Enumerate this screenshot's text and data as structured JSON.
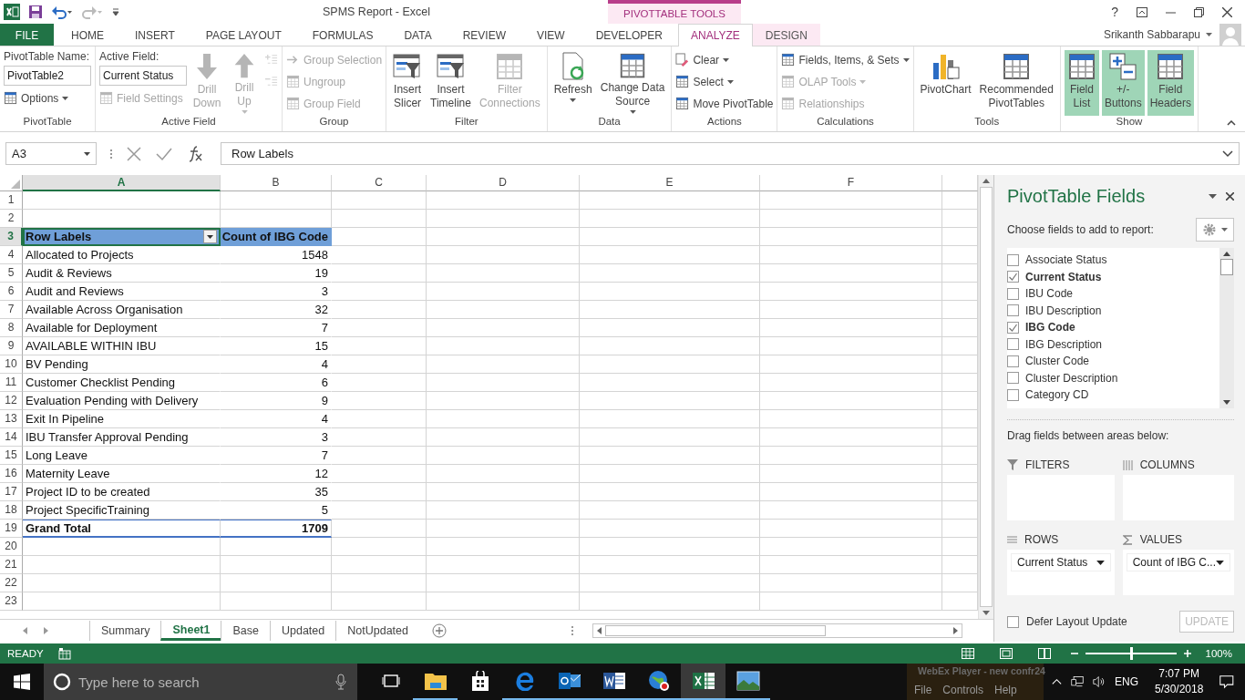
{
  "window": {
    "title": "SPMS Report - Excel",
    "help": "?",
    "context_group": "PIVOTTABLE TOOLS",
    "user": "Srikanth Sabbarapu"
  },
  "tabs": [
    {
      "label": "FILE",
      "kind": "file",
      "selected": false
    },
    {
      "label": "HOME",
      "kind": "normal",
      "selected": false
    },
    {
      "label": "INSERT",
      "kind": "normal",
      "selected": false
    },
    {
      "label": "PAGE LAYOUT",
      "kind": "normal",
      "selected": false
    },
    {
      "label": "FORMULAS",
      "kind": "normal",
      "selected": false
    },
    {
      "label": "DATA",
      "kind": "normal",
      "selected": false
    },
    {
      "label": "REVIEW",
      "kind": "normal",
      "selected": false
    },
    {
      "label": "VIEW",
      "kind": "normal",
      "selected": false
    },
    {
      "label": "DEVELOPER",
      "kind": "normal",
      "selected": false
    },
    {
      "label": "ANALYZE",
      "kind": "context",
      "selected": true
    },
    {
      "label": "DESIGN",
      "kind": "context",
      "selected": false
    }
  ],
  "ribbon": {
    "groups": [
      {
        "title": "PivotTable",
        "columns": [
          [
            {
              "kind": "field",
              "label": "PivotTable Name:",
              "value": "PivotTable2"
            },
            {
              "kind": "small",
              "label": "Options",
              "dropdown": true,
              "disabled": false
            }
          ]
        ]
      },
      {
        "title": "Active Field",
        "columns": [
          [
            {
              "kind": "field",
              "label": "Active Field:",
              "value": "Current Status"
            },
            {
              "kind": "small",
              "label": "Field Settings",
              "dropdown": false,
              "disabled": true
            }
          ],
          [
            {
              "kind": "large",
              "lines": [
                "Drill",
                "Down"
              ],
              "dropdown": false,
              "disabled": true
            }
          ],
          [
            {
              "kind": "large",
              "lines": [
                "Drill",
                "Up"
              ],
              "dropdown": true,
              "disabled": true
            }
          ],
          [
            {
              "kind": "icon",
              "disabled": true
            },
            {
              "kind": "icon",
              "disabled": true
            }
          ]
        ]
      },
      {
        "title": "Group",
        "columns": [
          [
            {
              "kind": "small",
              "label": "Group Selection",
              "dropdown": false,
              "disabled": true
            },
            {
              "kind": "small",
              "label": "Ungroup",
              "dropdown": false,
              "disabled": true
            },
            {
              "kind": "small",
              "label": "Group Field",
              "dropdown": false,
              "disabled": true
            }
          ]
        ]
      },
      {
        "title": "Filter",
        "columns": [
          [
            {
              "kind": "large",
              "lines": [
                "Insert",
                "Slicer"
              ],
              "dropdown": false,
              "disabled": false
            }
          ],
          [
            {
              "kind": "large",
              "lines": [
                "Insert",
                "Timeline"
              ],
              "dropdown": false,
              "disabled": false
            }
          ],
          [
            {
              "kind": "large",
              "lines": [
                "Filter",
                "Connections"
              ],
              "dropdown": false,
              "disabled": true
            }
          ]
        ]
      },
      {
        "title": "Data",
        "columns": [
          [
            {
              "kind": "large",
              "lines": [
                "Refresh"
              ],
              "dropdown": true,
              "disabled": false
            }
          ],
          [
            {
              "kind": "large",
              "lines": [
                "Change Data",
                "Source"
              ],
              "dropdown": true,
              "disabled": false
            }
          ]
        ]
      },
      {
        "title": "Actions",
        "columns": [
          [
            {
              "kind": "small",
              "label": "Clear",
              "dropdown": true,
              "disabled": false
            },
            {
              "kind": "small",
              "label": "Select",
              "dropdown": true,
              "disabled": false
            },
            {
              "kind": "small",
              "label": "Move PivotTable",
              "dropdown": false,
              "disabled": false
            }
          ]
        ]
      },
      {
        "title": "Calculations",
        "columns": [
          [
            {
              "kind": "small",
              "label": "Fields, Items, & Sets",
              "dropdown": true,
              "disabled": false
            },
            {
              "kind": "small",
              "label": "OLAP Tools",
              "dropdown": true,
              "disabled": true
            },
            {
              "kind": "small",
              "label": "Relationships",
              "dropdown": false,
              "disabled": true
            }
          ]
        ]
      },
      {
        "title": "Tools",
        "columns": [
          [
            {
              "kind": "large",
              "lines": [
                "PivotChart"
              ],
              "dropdown": false,
              "disabled": false
            }
          ],
          [
            {
              "kind": "large",
              "lines": [
                "Recommended",
                "PivotTables"
              ],
              "dropdown": false,
              "disabled": false
            }
          ]
        ]
      },
      {
        "title": "Show",
        "columns": [
          [
            {
              "kind": "large",
              "lines": [
                "Field",
                "List"
              ],
              "dropdown": false,
              "disabled": false,
              "on": true
            }
          ],
          [
            {
              "kind": "large",
              "lines": [
                "+/-",
                "Buttons"
              ],
              "dropdown": false,
              "disabled": false,
              "on": true
            }
          ],
          [
            {
              "kind": "large",
              "lines": [
                "Field",
                "Headers"
              ],
              "dropdown": false,
              "disabled": false,
              "on": true
            }
          ]
        ]
      }
    ]
  },
  "formula_bar": {
    "name_box": "A3",
    "formula": "Row Labels"
  },
  "sheet": {
    "columns": [
      "A",
      "B",
      "C",
      "D",
      "E",
      "F"
    ],
    "rows": [
      {
        "num": "1",
        "kind": "blank",
        "selected": false
      },
      {
        "num": "2",
        "kind": "blank",
        "selected": false
      },
      {
        "num": "3",
        "kind": "header",
        "label": "Row Labels",
        "value": "Count of IBG Code",
        "selected": true
      },
      {
        "num": "4",
        "kind": "item",
        "label": "Allocated to Projects",
        "value": "1548",
        "selected": false
      },
      {
        "num": "5",
        "kind": "item",
        "label": "Audit & Reviews",
        "value": "19",
        "selected": false
      },
      {
        "num": "6",
        "kind": "item",
        "label": "Audit and Reviews",
        "value": "3",
        "selected": false
      },
      {
        "num": "7",
        "kind": "item",
        "label": "Available Across Organisation",
        "value": "32",
        "selected": false
      },
      {
        "num": "8",
        "kind": "item",
        "label": "Available for Deployment",
        "value": "7",
        "selected": false
      },
      {
        "num": "9",
        "kind": "item",
        "label": "AVAILABLE WITHIN IBU",
        "value": "15",
        "selected": false
      },
      {
        "num": "10",
        "kind": "item",
        "label": "BV Pending",
        "value": "4",
        "selected": false
      },
      {
        "num": "11",
        "kind": "item",
        "label": "Customer Checklist Pending",
        "value": "6",
        "selected": false
      },
      {
        "num": "12",
        "kind": "item",
        "label": "Evaluation Pending with Delivery",
        "value": "9",
        "selected": false
      },
      {
        "num": "13",
        "kind": "item",
        "label": "Exit In Pipeline",
        "value": "4",
        "selected": false
      },
      {
        "num": "14",
        "kind": "item",
        "label": "IBU Transfer Approval Pending",
        "value": "3",
        "selected": false
      },
      {
        "num": "15",
        "kind": "item",
        "label": "Long Leave",
        "value": "7",
        "selected": false
      },
      {
        "num": "16",
        "kind": "item",
        "label": "Maternity Leave",
        "value": "12",
        "selected": false
      },
      {
        "num": "17",
        "kind": "item",
        "label": "Project ID to be created",
        "value": "35",
        "selected": false
      },
      {
        "num": "18",
        "kind": "item",
        "label": "Project SpecificTraining",
        "value": "5",
        "selected": false
      },
      {
        "num": "19",
        "kind": "total",
        "label": "Grand Total",
        "value": "1709",
        "selected": false
      },
      {
        "num": "20",
        "kind": "blank",
        "selected": false
      },
      {
        "num": "21",
        "kind": "blank",
        "selected": false
      },
      {
        "num": "22",
        "kind": "blank",
        "selected": false
      },
      {
        "num": "23",
        "kind": "blank",
        "selected": false
      }
    ],
    "tabs": [
      {
        "label": "Summary",
        "selected": false
      },
      {
        "label": "Sheet1",
        "selected": true
      },
      {
        "label": "Base",
        "selected": false
      },
      {
        "label": "Updated",
        "selected": false
      },
      {
        "label": "NotUpdated",
        "selected": false
      }
    ]
  },
  "fields_pane": {
    "title": "PivotTable Fields",
    "subtitle": "Choose fields to add to report:",
    "fields": [
      {
        "label": "Associate Status",
        "checked": false
      },
      {
        "label": "Current Status",
        "checked": true
      },
      {
        "label": "IBU Code",
        "checked": false
      },
      {
        "label": "IBU Description",
        "checked": false
      },
      {
        "label": "IBG Code",
        "checked": true
      },
      {
        "label": "IBG Description",
        "checked": false
      },
      {
        "label": "Cluster Code",
        "checked": false
      },
      {
        "label": "Cluster Description",
        "checked": false
      },
      {
        "label": "Category CD",
        "checked": false
      }
    ],
    "hint": "Drag fields between areas below:",
    "areas": [
      {
        "kind": "filters",
        "title": "FILTERS"
      },
      {
        "kind": "columns",
        "title": "COLUMNS"
      },
      {
        "kind": "rows",
        "title": "ROWS",
        "items": [
          "Current Status"
        ]
      },
      {
        "kind": "values",
        "title": "VALUES",
        "items": [
          "Count of IBG C..."
        ]
      }
    ],
    "defer": {
      "label": "Defer Layout Update",
      "checked": false
    },
    "update_button": {
      "label": "UPDATE",
      "disabled": true
    }
  },
  "status_bar": {
    "text": "READY",
    "zoom": "100%",
    "zoom_slider": {
      "level": 0.5
    }
  },
  "taskbar": {
    "search_placeholder": "Type here to search",
    "apps": [
      {
        "open": true,
        "selected": false
      },
      {
        "open": false,
        "selected": false
      },
      {
        "open": true,
        "selected": false
      },
      {
        "open": true,
        "selected": false
      },
      {
        "open": true,
        "selected": false
      },
      {
        "open": true,
        "selected": false
      },
      {
        "open": true,
        "selected": true
      },
      {
        "open": true,
        "selected": false
      }
    ],
    "language": "ENG",
    "time": "7:07 PM",
    "date": "5/30/2018"
  },
  "webex": {
    "title": "WebEx Player - new confr24",
    "menu": [
      "File",
      "Controls",
      "Help"
    ]
  }
}
